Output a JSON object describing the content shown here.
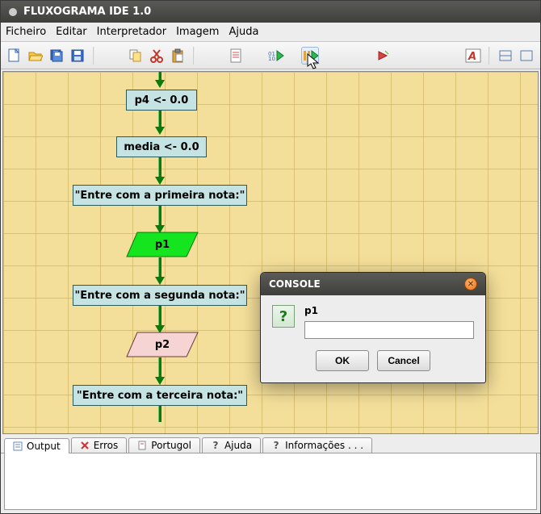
{
  "window": {
    "title": "FLUXOGRAMA IDE 1.0"
  },
  "menu": {
    "ficheiro": "Ficheiro",
    "editar": "Editar",
    "interpretador": "Interpretador",
    "imagem": "Imagem",
    "ajuda": "Ajuda"
  },
  "toolbar_icons": {
    "new": "new-file",
    "open": "open-folder",
    "save": "save",
    "saveall": "save-all",
    "copy": "copy",
    "cut": "cut",
    "paste": "paste",
    "doc": "doc",
    "run": "run",
    "pause": "pause",
    "stop": "stop",
    "font": "font",
    "min": "minimize",
    "max": "maximize"
  },
  "nodes": {
    "p4": "p4 <- 0.0",
    "media": "media <- 0.0",
    "prompt1": "\"Entre com a primeira nota:\"",
    "p1": "p1",
    "prompt2": "\"Entre com a segunda nota:\"",
    "p2": "p2",
    "prompt3": "\"Entre com a terceira nota:\""
  },
  "dialog": {
    "title": "CONSOLE",
    "prompt": "p1",
    "value": "",
    "ok": "OK",
    "cancel": "Cancel"
  },
  "tabs": {
    "output": "Output",
    "erros": "Erros",
    "portugol": "Portugol",
    "ajuda": "Ajuda",
    "informacoes": "Informações . . ."
  },
  "chart_data": {
    "type": "flowchart",
    "nodes": [
      {
        "id": "p4",
        "kind": "process",
        "label": "p4 <- 0.0"
      },
      {
        "id": "media",
        "kind": "process",
        "label": "media <- 0.0"
      },
      {
        "id": "out1",
        "kind": "output",
        "label": "\"Entre com a primeira nota:\""
      },
      {
        "id": "in1",
        "kind": "input",
        "label": "p1",
        "highlighted": true
      },
      {
        "id": "out2",
        "kind": "output",
        "label": "\"Entre com a segunda nota:\""
      },
      {
        "id": "in2",
        "kind": "input",
        "label": "p2"
      },
      {
        "id": "out3",
        "kind": "output",
        "label": "\"Entre com a terceira nota:\""
      }
    ],
    "edges": [
      [
        "p4",
        "media"
      ],
      [
        "media",
        "out1"
      ],
      [
        "out1",
        "in1"
      ],
      [
        "in1",
        "out2"
      ],
      [
        "out2",
        "in2"
      ],
      [
        "in2",
        "out3"
      ]
    ]
  }
}
